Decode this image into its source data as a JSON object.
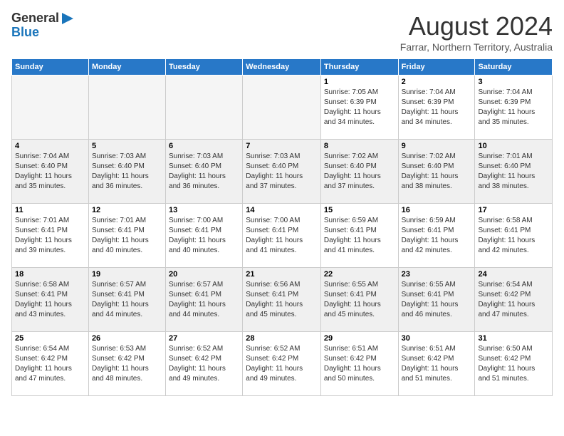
{
  "header": {
    "logo_line1": "General",
    "logo_line2": "Blue",
    "month_year": "August 2024",
    "location": "Farrar, Northern Territory, Australia"
  },
  "weekdays": [
    "Sunday",
    "Monday",
    "Tuesday",
    "Wednesday",
    "Thursday",
    "Friday",
    "Saturday"
  ],
  "weeks": [
    [
      {
        "day": "",
        "info": ""
      },
      {
        "day": "",
        "info": ""
      },
      {
        "day": "",
        "info": ""
      },
      {
        "day": "",
        "info": ""
      },
      {
        "day": "1",
        "info": "Sunrise: 7:05 AM\nSunset: 6:39 PM\nDaylight: 11 hours\nand 34 minutes."
      },
      {
        "day": "2",
        "info": "Sunrise: 7:04 AM\nSunset: 6:39 PM\nDaylight: 11 hours\nand 34 minutes."
      },
      {
        "day": "3",
        "info": "Sunrise: 7:04 AM\nSunset: 6:39 PM\nDaylight: 11 hours\nand 35 minutes."
      }
    ],
    [
      {
        "day": "4",
        "info": "Sunrise: 7:04 AM\nSunset: 6:40 PM\nDaylight: 11 hours\nand 35 minutes."
      },
      {
        "day": "5",
        "info": "Sunrise: 7:03 AM\nSunset: 6:40 PM\nDaylight: 11 hours\nand 36 minutes."
      },
      {
        "day": "6",
        "info": "Sunrise: 7:03 AM\nSunset: 6:40 PM\nDaylight: 11 hours\nand 36 minutes."
      },
      {
        "day": "7",
        "info": "Sunrise: 7:03 AM\nSunset: 6:40 PM\nDaylight: 11 hours\nand 37 minutes."
      },
      {
        "day": "8",
        "info": "Sunrise: 7:02 AM\nSunset: 6:40 PM\nDaylight: 11 hours\nand 37 minutes."
      },
      {
        "day": "9",
        "info": "Sunrise: 7:02 AM\nSunset: 6:40 PM\nDaylight: 11 hours\nand 38 minutes."
      },
      {
        "day": "10",
        "info": "Sunrise: 7:01 AM\nSunset: 6:40 PM\nDaylight: 11 hours\nand 38 minutes."
      }
    ],
    [
      {
        "day": "11",
        "info": "Sunrise: 7:01 AM\nSunset: 6:41 PM\nDaylight: 11 hours\nand 39 minutes."
      },
      {
        "day": "12",
        "info": "Sunrise: 7:01 AM\nSunset: 6:41 PM\nDaylight: 11 hours\nand 40 minutes."
      },
      {
        "day": "13",
        "info": "Sunrise: 7:00 AM\nSunset: 6:41 PM\nDaylight: 11 hours\nand 40 minutes."
      },
      {
        "day": "14",
        "info": "Sunrise: 7:00 AM\nSunset: 6:41 PM\nDaylight: 11 hours\nand 41 minutes."
      },
      {
        "day": "15",
        "info": "Sunrise: 6:59 AM\nSunset: 6:41 PM\nDaylight: 11 hours\nand 41 minutes."
      },
      {
        "day": "16",
        "info": "Sunrise: 6:59 AM\nSunset: 6:41 PM\nDaylight: 11 hours\nand 42 minutes."
      },
      {
        "day": "17",
        "info": "Sunrise: 6:58 AM\nSunset: 6:41 PM\nDaylight: 11 hours\nand 42 minutes."
      }
    ],
    [
      {
        "day": "18",
        "info": "Sunrise: 6:58 AM\nSunset: 6:41 PM\nDaylight: 11 hours\nand 43 minutes."
      },
      {
        "day": "19",
        "info": "Sunrise: 6:57 AM\nSunset: 6:41 PM\nDaylight: 11 hours\nand 44 minutes."
      },
      {
        "day": "20",
        "info": "Sunrise: 6:57 AM\nSunset: 6:41 PM\nDaylight: 11 hours\nand 44 minutes."
      },
      {
        "day": "21",
        "info": "Sunrise: 6:56 AM\nSunset: 6:41 PM\nDaylight: 11 hours\nand 45 minutes."
      },
      {
        "day": "22",
        "info": "Sunrise: 6:55 AM\nSunset: 6:41 PM\nDaylight: 11 hours\nand 45 minutes."
      },
      {
        "day": "23",
        "info": "Sunrise: 6:55 AM\nSunset: 6:41 PM\nDaylight: 11 hours\nand 46 minutes."
      },
      {
        "day": "24",
        "info": "Sunrise: 6:54 AM\nSunset: 6:42 PM\nDaylight: 11 hours\nand 47 minutes."
      }
    ],
    [
      {
        "day": "25",
        "info": "Sunrise: 6:54 AM\nSunset: 6:42 PM\nDaylight: 11 hours\nand 47 minutes."
      },
      {
        "day": "26",
        "info": "Sunrise: 6:53 AM\nSunset: 6:42 PM\nDaylight: 11 hours\nand 48 minutes."
      },
      {
        "day": "27",
        "info": "Sunrise: 6:52 AM\nSunset: 6:42 PM\nDaylight: 11 hours\nand 49 minutes."
      },
      {
        "day": "28",
        "info": "Sunrise: 6:52 AM\nSunset: 6:42 PM\nDaylight: 11 hours\nand 49 minutes."
      },
      {
        "day": "29",
        "info": "Sunrise: 6:51 AM\nSunset: 6:42 PM\nDaylight: 11 hours\nand 50 minutes."
      },
      {
        "day": "30",
        "info": "Sunrise: 6:51 AM\nSunset: 6:42 PM\nDaylight: 11 hours\nand 51 minutes."
      },
      {
        "day": "31",
        "info": "Sunrise: 6:50 AM\nSunset: 6:42 PM\nDaylight: 11 hours\nand 51 minutes."
      }
    ]
  ]
}
